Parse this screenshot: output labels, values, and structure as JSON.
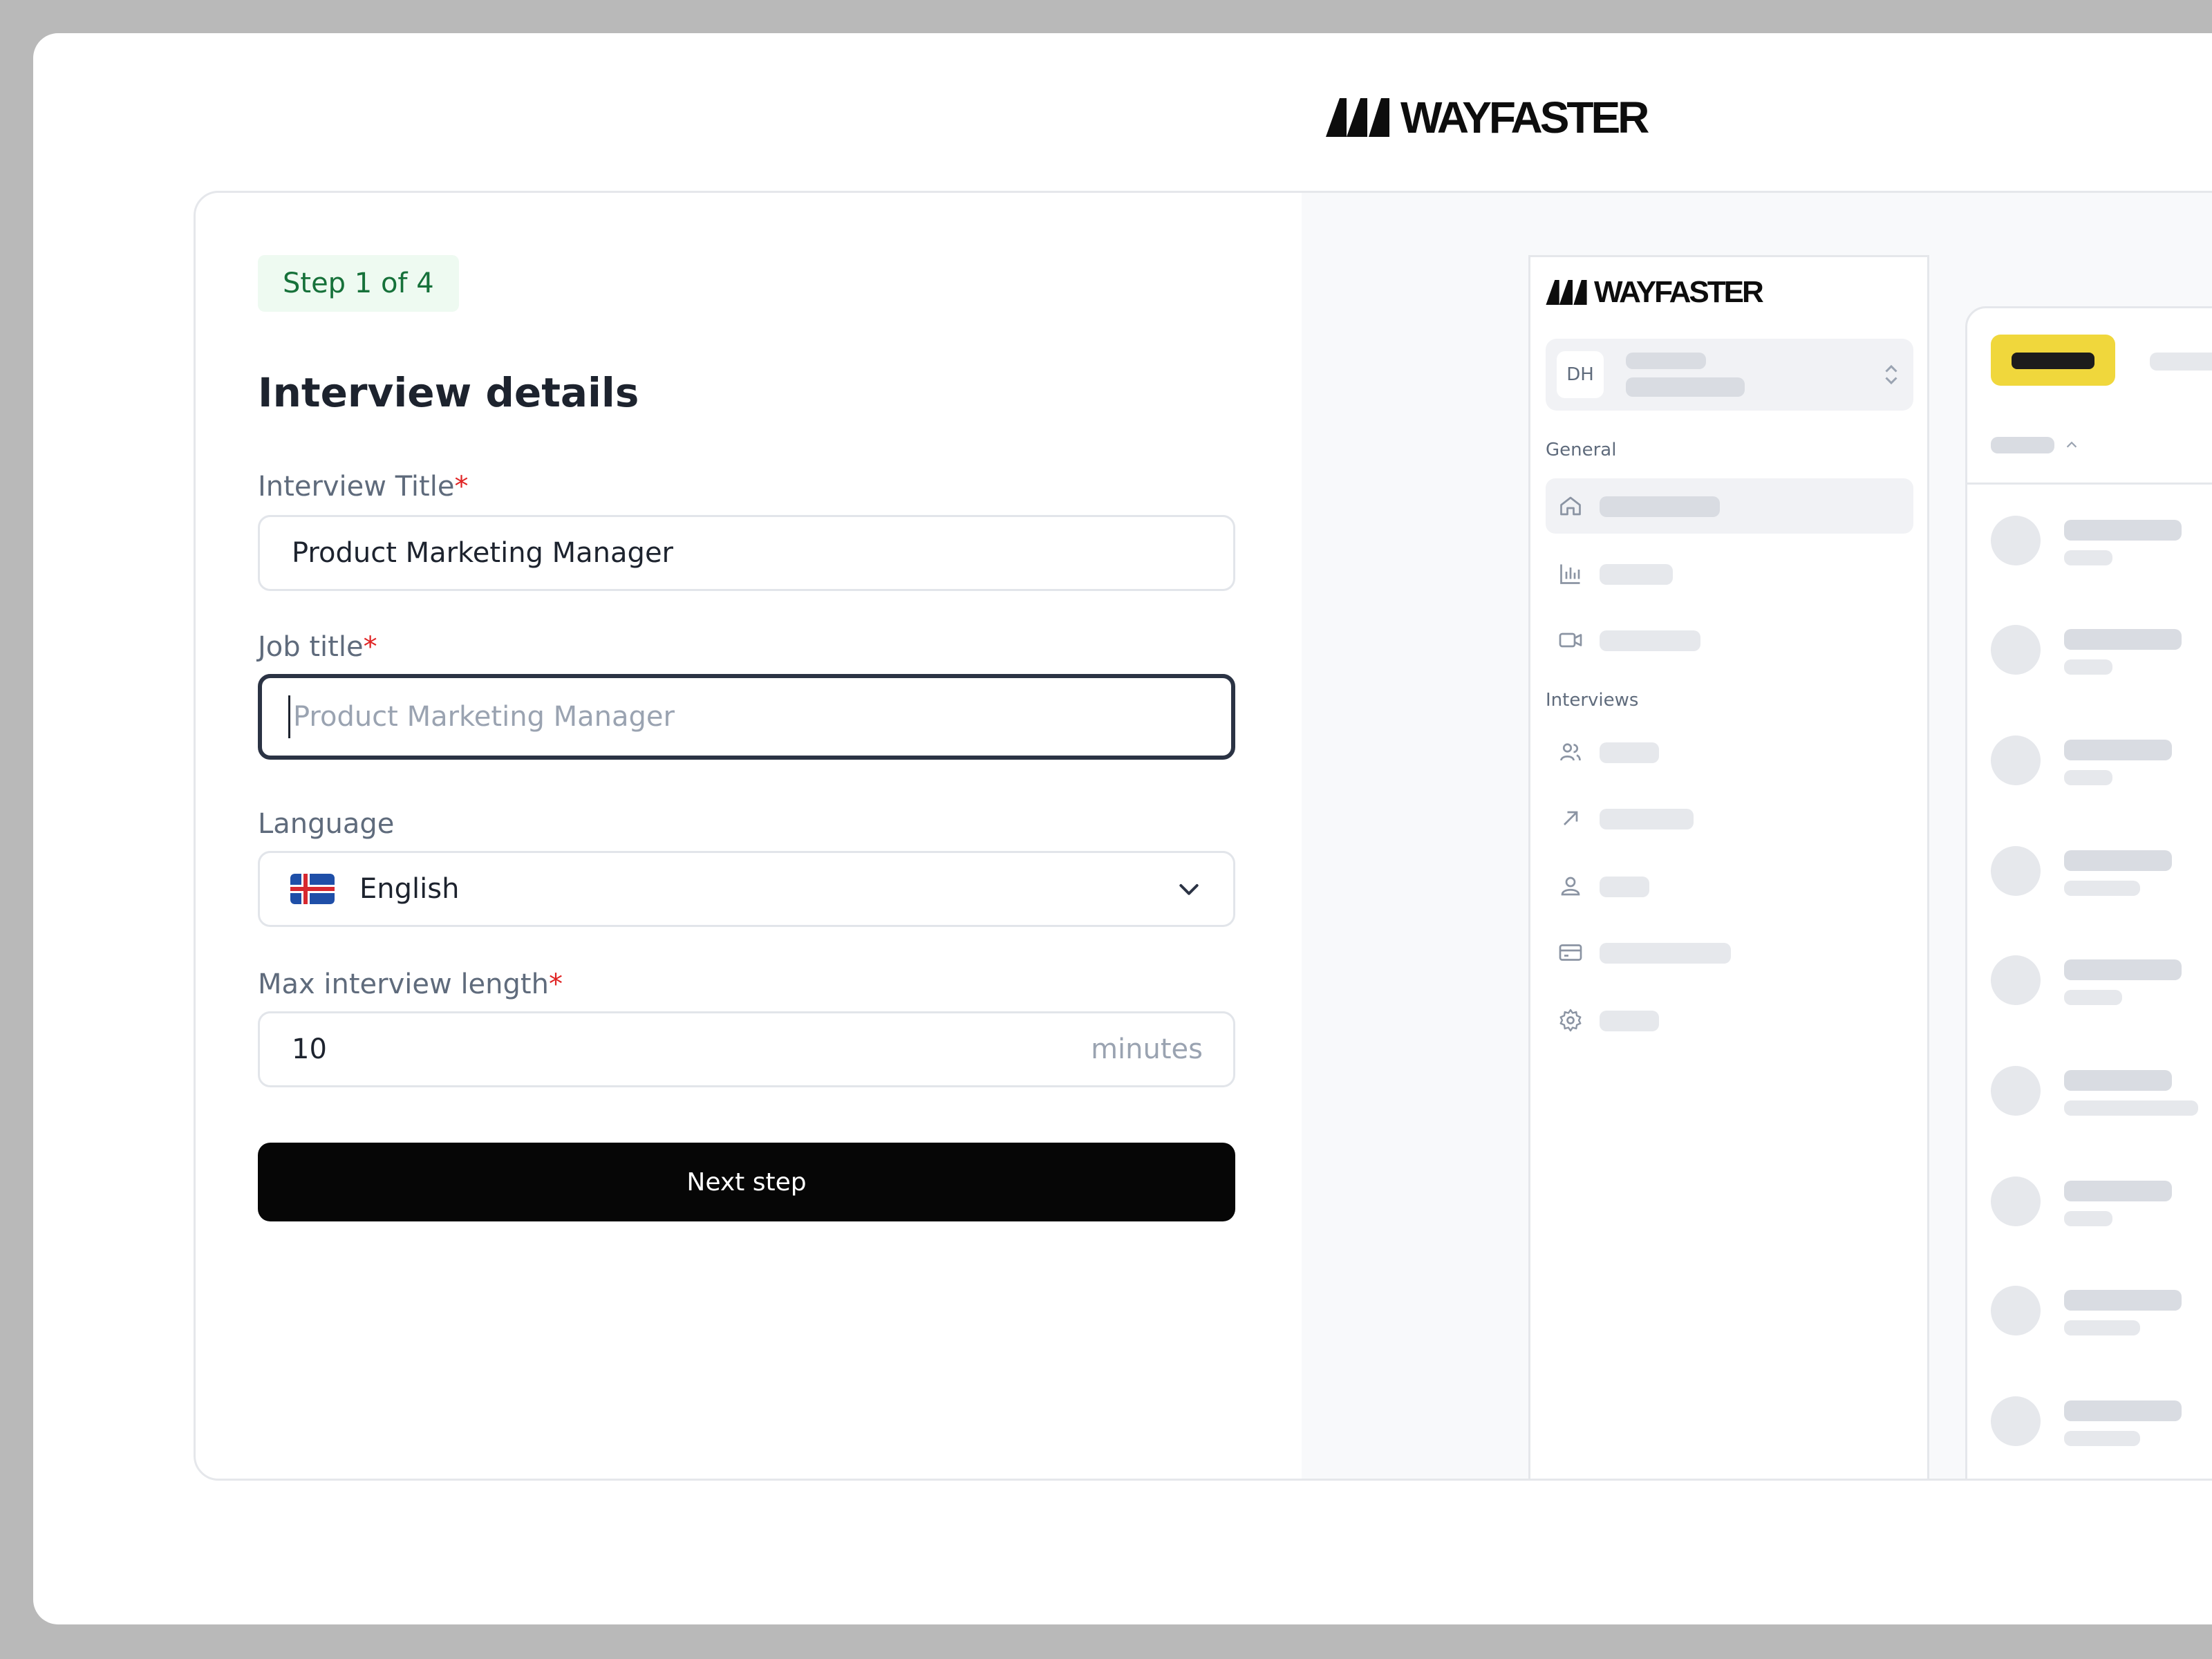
{
  "brand": {
    "name": "WAYFASTER"
  },
  "form": {
    "step_badge": "Step 1 of 4",
    "title": "Interview details",
    "interview_title": {
      "label": "Interview Title",
      "required_mark": "*",
      "value": "Product Marketing Manager"
    },
    "job_title": {
      "label": "Job title",
      "required_mark": "*",
      "value": "",
      "placeholder": "Product Marketing Manager"
    },
    "language": {
      "label": "Language",
      "value": "English"
    },
    "max_length": {
      "label": "Max interview length",
      "required_mark": "*",
      "value": "10",
      "suffix": "minutes"
    },
    "next_button": "Next step"
  },
  "preview": {
    "workspace_initials": "DH",
    "section_general": "General",
    "section_interviews": "Interviews",
    "nav_icons_general": [
      "home-icon",
      "bar-chart-icon",
      "video-icon"
    ],
    "nav_icons_interviews": [
      "users-icon",
      "arrow-up-right-icon",
      "user-icon",
      "credit-card-icon",
      "gear-icon"
    ]
  },
  "colors": {
    "step_badge_bg": "#eefaf1",
    "step_badge_text": "#16713a",
    "required": "#e02424",
    "button": "#060606",
    "preview_accent": "#f0d73c"
  }
}
